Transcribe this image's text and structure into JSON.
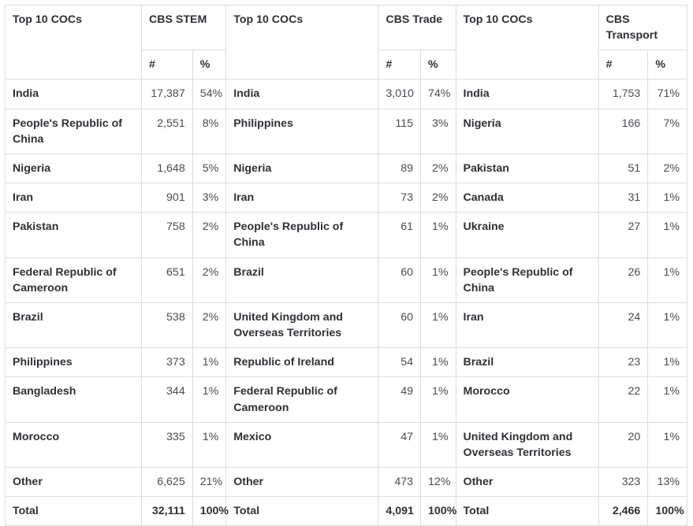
{
  "table": {
    "groups": [
      {
        "coc_header": "Top 10 COCs",
        "group_header": "CBS STEM",
        "num_header": "#",
        "pct_header": "%"
      },
      {
        "coc_header": "Top 10 COCs",
        "group_header": "CBS Trade",
        "num_header": "#",
        "pct_header": "%"
      },
      {
        "coc_header": "Top 10 COCs",
        "group_header": "CBS Transport",
        "num_header": "#",
        "pct_header": "%"
      }
    ],
    "rows": [
      {
        "stem": {
          "coc": "India",
          "num": "17,387",
          "pct": "54%"
        },
        "trade": {
          "coc": "India",
          "num": "3,010",
          "pct": "74%"
        },
        "transport": {
          "coc": "India",
          "num": "1,753",
          "pct": "71%"
        }
      },
      {
        "stem": {
          "coc": "People's Republic of China",
          "num": "2,551",
          "pct": "8%"
        },
        "trade": {
          "coc": "Philippines",
          "num": "115",
          "pct": "3%"
        },
        "transport": {
          "coc": "Nigeria",
          "num": "166",
          "pct": "7%"
        }
      },
      {
        "stem": {
          "coc": "Nigeria",
          "num": "1,648",
          "pct": "5%"
        },
        "trade": {
          "coc": "Nigeria",
          "num": "89",
          "pct": "2%"
        },
        "transport": {
          "coc": "Pakistan",
          "num": "51",
          "pct": "2%"
        }
      },
      {
        "stem": {
          "coc": "Iran",
          "num": "901",
          "pct": "3%"
        },
        "trade": {
          "coc": "Iran",
          "num": "73",
          "pct": "2%"
        },
        "transport": {
          "coc": "Canada",
          "num": "31",
          "pct": "1%"
        }
      },
      {
        "stem": {
          "coc": "Pakistan",
          "num": "758",
          "pct": "2%"
        },
        "trade": {
          "coc": "People's Republic of China",
          "num": "61",
          "pct": "1%"
        },
        "transport": {
          "coc": "Ukraine",
          "num": "27",
          "pct": "1%"
        }
      },
      {
        "stem": {
          "coc": "Federal Republic of Cameroon",
          "num": "651",
          "pct": "2%"
        },
        "trade": {
          "coc": "Brazil",
          "num": "60",
          "pct": "1%"
        },
        "transport": {
          "coc": "People's Republic of China",
          "num": "26",
          "pct": "1%"
        }
      },
      {
        "stem": {
          "coc": "Brazil",
          "num": "538",
          "pct": "2%"
        },
        "trade": {
          "coc": "United Kingdom and Overseas Territories",
          "num": "60",
          "pct": "1%"
        },
        "transport": {
          "coc": "Iran",
          "num": "24",
          "pct": "1%"
        }
      },
      {
        "stem": {
          "coc": "Philippines",
          "num": "373",
          "pct": "1%"
        },
        "trade": {
          "coc": "Republic of Ireland",
          "num": "54",
          "pct": "1%"
        },
        "transport": {
          "coc": "Brazil",
          "num": "23",
          "pct": "1%"
        }
      },
      {
        "stem": {
          "coc": "Bangladesh",
          "num": "344",
          "pct": "1%"
        },
        "trade": {
          "coc": "Federal Republic of Cameroon",
          "num": "49",
          "pct": "1%"
        },
        "transport": {
          "coc": "Morocco",
          "num": "22",
          "pct": "1%"
        }
      },
      {
        "stem": {
          "coc": "Morocco",
          "num": "335",
          "pct": "1%"
        },
        "trade": {
          "coc": "Mexico",
          "num": "47",
          "pct": "1%"
        },
        "transport": {
          "coc": "United Kingdom and Overseas Territories",
          "num": "20",
          "pct": "1%"
        }
      },
      {
        "stem": {
          "coc": "Other",
          "num": "6,625",
          "pct": "21%"
        },
        "trade": {
          "coc": "Other",
          "num": "473",
          "pct": "12%"
        },
        "transport": {
          "coc": "Other",
          "num": "323",
          "pct": "13%"
        }
      }
    ],
    "total_row": {
      "stem": {
        "coc": "Total",
        "num": "32,111",
        "pct": "100%"
      },
      "trade": {
        "coc": "Total",
        "num": "4,091",
        "pct": "100%"
      },
      "transport": {
        "coc": "Total",
        "num": "2,466",
        "pct": "100%"
      }
    }
  }
}
